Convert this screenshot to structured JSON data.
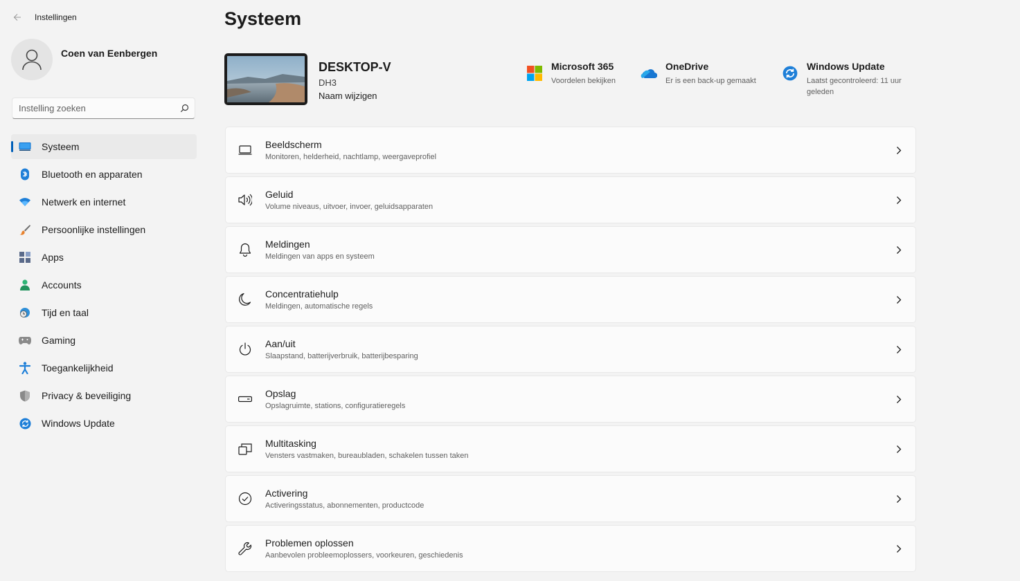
{
  "app": {
    "title": "Instellingen"
  },
  "user": {
    "name": "Coen van Eenbergen"
  },
  "search": {
    "placeholder": "Instelling zoeken"
  },
  "nav": [
    {
      "label": "Systeem",
      "icon": "monitor-icon",
      "active": true
    },
    {
      "label": "Bluetooth en apparaten",
      "icon": "bluetooth-icon"
    },
    {
      "label": "Netwerk en internet",
      "icon": "wifi-icon"
    },
    {
      "label": "Persoonlijke instellingen",
      "icon": "brush-icon"
    },
    {
      "label": "Apps",
      "icon": "apps-icon"
    },
    {
      "label": "Accounts",
      "icon": "person-icon"
    },
    {
      "label": "Tijd en taal",
      "icon": "globe-clock-icon"
    },
    {
      "label": "Gaming",
      "icon": "gamepad-icon"
    },
    {
      "label": "Toegankelijkheid",
      "icon": "accessibility-icon"
    },
    {
      "label": "Privacy & beveiliging",
      "icon": "shield-icon"
    },
    {
      "label": "Windows Update",
      "icon": "update-icon"
    }
  ],
  "page": {
    "title": "Systeem"
  },
  "device": {
    "name": "DESKTOP-V",
    "model": "DH3",
    "rename": "Naam wijzigen"
  },
  "quick": [
    {
      "title": "Microsoft 365",
      "subtitle": "Voordelen bekijken",
      "icon": "microsoft-logo-icon"
    },
    {
      "title": "OneDrive",
      "subtitle": "Er is een back-up gemaakt",
      "icon": "cloud-icon"
    },
    {
      "title": "Windows Update",
      "subtitle": "Laatst gecontroleerd: 11 uur geleden",
      "icon": "update-icon"
    }
  ],
  "cards": [
    {
      "title": "Beeldscherm",
      "subtitle": "Monitoren, helderheid, nachtlamp, weergaveprofiel",
      "icon": "display-icon"
    },
    {
      "title": "Geluid",
      "subtitle": "Volume niveaus, uitvoer, invoer, geluidsapparaten",
      "icon": "speaker-icon"
    },
    {
      "title": "Meldingen",
      "subtitle": "Meldingen van apps en systeem",
      "icon": "bell-icon"
    },
    {
      "title": "Concentratiehulp",
      "subtitle": "Meldingen, automatische regels",
      "icon": "moon-icon"
    },
    {
      "title": "Aan/uit",
      "subtitle": "Slaapstand, batterijverbruik, batterijbesparing",
      "icon": "power-icon"
    },
    {
      "title": "Opslag",
      "subtitle": "Opslagruimte, stations, configuratieregels",
      "icon": "storage-icon"
    },
    {
      "title": "Multitasking",
      "subtitle": "Vensters vastmaken, bureaubladen, schakelen tussen taken",
      "icon": "multitasking-icon"
    },
    {
      "title": "Activering",
      "subtitle": "Activeringsstatus, abonnementen, productcode",
      "icon": "check-circle-icon"
    },
    {
      "title": "Problemen oplossen",
      "subtitle": "Aanbevolen probleemoplossers, voorkeuren, geschiedenis",
      "icon": "wrench-icon"
    }
  ],
  "colors": {
    "accent": "#005fb8",
    "background": "#f3f3f3",
    "card": "#fbfbfb"
  }
}
